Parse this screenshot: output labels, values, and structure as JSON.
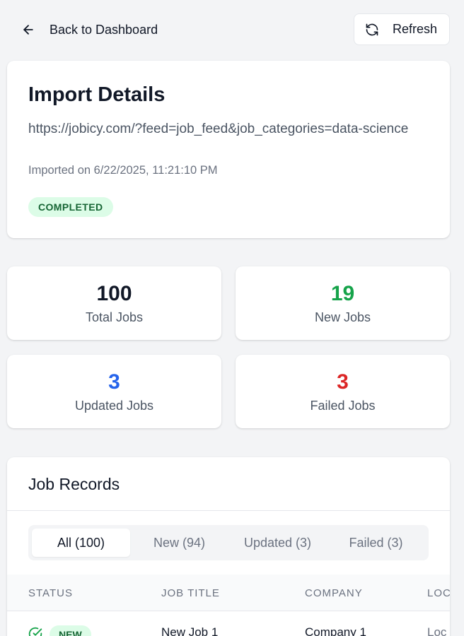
{
  "header": {
    "back_label": "Back to Dashboard",
    "refresh_label": "Refresh"
  },
  "import": {
    "title": "Import Details",
    "url": "https://jobicy.com/?feed=job_feed&job_categories=data-science",
    "imported_on": "Imported on 6/22/2025, 11:21:10 PM",
    "status": "COMPLETED"
  },
  "stats": [
    {
      "value": "100",
      "label": "Total Jobs",
      "color": "#111827"
    },
    {
      "value": "19",
      "label": "New Jobs",
      "color": "#16a34a"
    },
    {
      "value": "3",
      "label": "Updated Jobs",
      "color": "#2563eb"
    },
    {
      "value": "3",
      "label": "Failed Jobs",
      "color": "#dc2626"
    }
  ],
  "records": {
    "title": "Job Records",
    "tabs": [
      "All (100)",
      "New (94)",
      "Updated (3)",
      "Failed (3)"
    ],
    "active_tab": 0,
    "columns": [
      "STATUS",
      "JOB TITLE",
      "COMPANY",
      "LOC"
    ],
    "rows": [
      {
        "status": "NEW",
        "title": "New Job 1",
        "company": "Company 1",
        "location": "Loc"
      }
    ]
  },
  "colors": {
    "accent_green": "#16a34a",
    "accent_blue": "#2563eb",
    "accent_red": "#dc2626"
  }
}
